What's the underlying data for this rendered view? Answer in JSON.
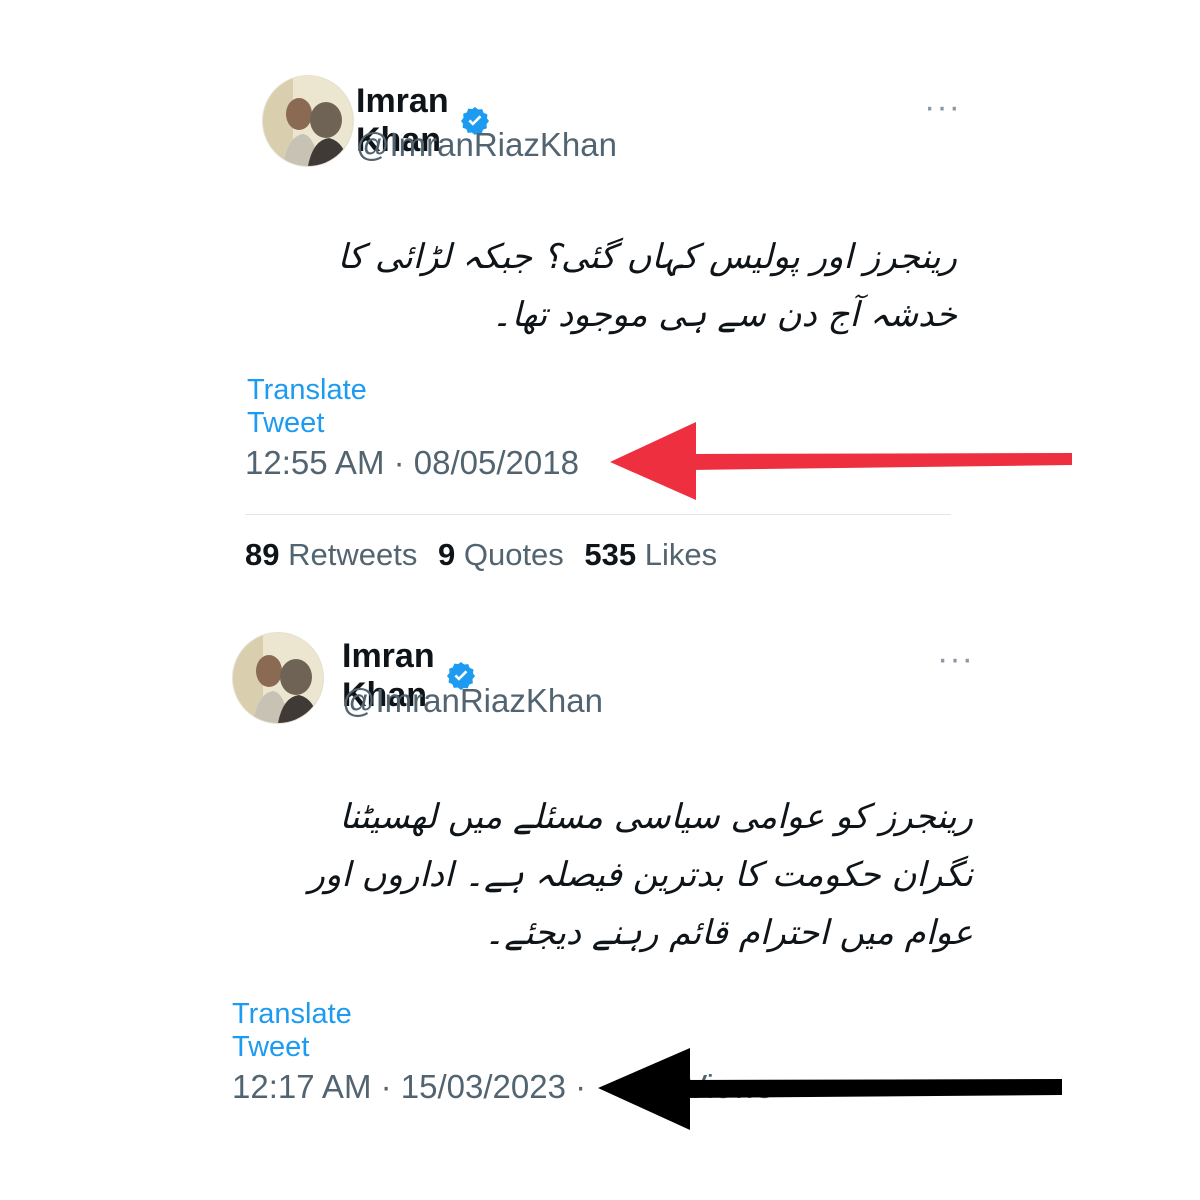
{
  "tweets": [
    {
      "name": "Imran Khan",
      "handle": "@ImranRiazKhan",
      "more": "···",
      "text": "رینجرز اور پولیس کہاں گئی؟ جبکہ لڑائی کا خدشہ آج دن سے ہی موجود تھا۔",
      "translate": "Translate Tweet",
      "timestamp": "12:55 AM · 08/05/2018",
      "stats": {
        "retweets_count": "89",
        "retweets_label": "Retweets",
        "quotes_count": "9",
        "quotes_label": "Quotes",
        "likes_count": "535",
        "likes_label": "Likes"
      }
    },
    {
      "name": "Imran Khan",
      "handle": "@ImranRiazKhan",
      "more": "···",
      "text": "رینجرز کو عوامی سیاسی مسئلے میں لھسیٹنا نگران حکومت کا بدترین فیصلہ ہے۔ اداروں اور عوام میں احترام قائم رہنے دیجئے۔",
      "translate": "Translate Tweet",
      "timestamp": "12:17 AM · 15/03/2023 · ",
      "views": "Views"
    }
  ],
  "icons": {
    "verified": "verified-badge-icon",
    "more": "more-icon",
    "arrow_red": "arrow-left-icon",
    "arrow_black": "arrow-left-icon"
  },
  "colors": {
    "verified": "#1d9bf0",
    "link": "#1d9bf0",
    "arrow_red": "#ee2f40",
    "arrow_black": "#000000"
  }
}
